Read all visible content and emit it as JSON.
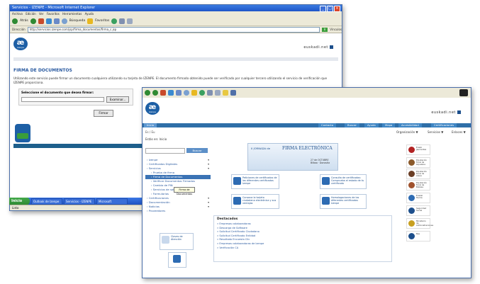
{
  "back": {
    "title": "Servicios - IZENPE - Microsoft Internet Explorer",
    "menu": "Archivo   Edición   Ver   Favoritos   Herramientas   Ayuda",
    "toolbar": {
      "back": "Atrás",
      "search": "Búsqueda",
      "favorites": "Favoritos"
    },
    "address_label": "Dirección",
    "address": "http://servicios.izenpe.com/jsp/firma_documentos/firma_c.jsp",
    "go": "Ir",
    "links": "Vínculos",
    "logo_sub": "izenpe",
    "euskadi": "euskadi.net",
    "page_title": "FIRMA DE DOCUMENTOS",
    "description": "Utilizando este servicio puede firmar un documento cualquiera utilizando su tarjeta de IZENPE. El documento firmado obtenido puede ser verificado por cualquier tercero utilizando el servicio de verificación que IZENPE proporciona.",
    "select_label": "Seleccione el documento que desea firmar:",
    "browse": "Examinar...",
    "sign": "Firmar",
    "status": "Listo",
    "taskbar": {
      "start": "Inicio",
      "tasks": [
        "Outlook de Izenpe",
        "Servicios - IZENPE",
        "Microsoft"
      ]
    }
  },
  "front": {
    "logo_sub": "izenpe",
    "euskadi": "euskadi.net",
    "nav": [
      "Inicio",
      "Contacto",
      "Buscar",
      "Ayuda",
      "Mapa",
      "Accesibilidad",
      "Certificaciones"
    ],
    "breadcrumb": "Es / Eu",
    "dropdowns": [
      "Organización ▼",
      "Servicios ▼",
      "Enlaces ▼"
    ],
    "side_header": "Estás en: Inicio",
    "search_button": "Buscar",
    "menu": [
      {
        "label": "› Izenpe",
        "sub": false,
        "arrow": true
      },
      {
        "label": "› Certificados Digitales",
        "sub": false,
        "arrow": true
      },
      {
        "label": "› Servicios",
        "sub": false,
        "arrow": true
      },
      {
        "label": "› Prueba de firma",
        "sub": true,
        "arrow": false
      },
      {
        "label": "› Firma de Documentos",
        "sub": true,
        "arrow": false,
        "active": true
      },
      {
        "label": "› Verificar Documentos Firmados",
        "sub": true,
        "arrow": false
      },
      {
        "label": "› Cambio de PIN",
        "sub": true,
        "arrow": false
      },
      {
        "label": "› Servicios de software",
        "sub": true,
        "arrow": false
      },
      {
        "label": "› Formularios",
        "sub": true,
        "arrow": false
      },
      {
        "label": "› Certificaciones",
        "sub": false,
        "arrow": true
      },
      {
        "label": "› Documentación",
        "sub": false,
        "arrow": true
      },
      {
        "label": "› Noticias",
        "sub": false,
        "arrow": true
      },
      {
        "label": "› Proveedores",
        "sub": false,
        "arrow": false
      }
    ],
    "tooltip": "Firma de Documentos",
    "side_cards": [
      "Claves de Atención",
      "Herramientas"
    ],
    "jornada": {
      "pre": "II JORNADA de",
      "main": "FIRMA ELECTRÓNICA",
      "date": "27 de OCTUBRE",
      "place": "Bilbao · Donostia"
    },
    "cards": [
      "Peticiones de certificados de los diferentes certificados Izenpe",
      "Consulta de certificados: Comprueba el estado de tu certificado",
      "Conozca la tarjeta ciudadana electrónica y sus ventajas",
      "Homologaciones de los diferentes certificados Izenpe"
    ],
    "destacados_title": "Destacados",
    "destacados": [
      "» Empresas colaboradoras",
      "» Descarga de Software",
      "» Solicitud Certificado Ciudadano",
      "» Solicitud Certificado Entidad",
      "» Resultado Encuesta Clic",
      "» Empresas colaboradoras de Izenpe",
      "» Verificación CA"
    ],
    "right_logos": [
      {
        "text": "Eusko Jaurlaritza",
        "color": "#b22222"
      },
      {
        "text": "Diputación Foral de Gipuzkoa",
        "color": "#8b5a2b"
      },
      {
        "text": "Diputación Foral de Álava",
        "color": "#6b3e26"
      },
      {
        "text": "Diputación Foral de Bizkaia",
        "color": "#a0522d"
      },
      {
        "text": "Euskal Herria",
        "color": "#2d6bb3"
      },
      {
        "text": "Seguridad Social",
        "color": "#1d4f8c"
      },
      {
        "text": "Ministerio de Administraciones",
        "color": "#c8a020"
      },
      {
        "text": "Ejie",
        "color": "#1d4f8c"
      }
    ]
  },
  "colors": {
    "accent": "#1d5fa5",
    "xp_blue": "#1e55c8",
    "xp_chrome": "#ece9d8",
    "nav": "#2f6fa8"
  }
}
